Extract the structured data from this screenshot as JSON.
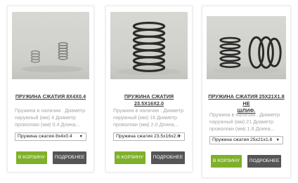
{
  "products": [
    {
      "title": "ПРУЖИНА СЖАТИЯ 8Х4Х0.4",
      "desc_lines": [
        "Пружина в наличии . Диаметр",
        "наружный (мм) 4 Диаметр",
        "проволоки (мм) 0.4 Длина..."
      ],
      "selected_option": "Пружина сжатия 8х4х0.4",
      "cart_label": "В КОРЗИНУ",
      "more_label": "ПОДРОБНЕЕ"
    },
    {
      "title": "ПРУЖИНА СЖАТИЯ 23.5Х16Х2.0",
      "desc_lines": [
        "Пружина в наличии . Диаметр",
        "наружный (мм) 16 Диаметр",
        "проволоки (мм) 2.0 Длина..."
      ],
      "selected_option": "Пружина сжатия 23.5х16х2.0",
      "cart_label": "В КОРЗИНУ",
      "more_label": "ПОДРОБНЕЕ"
    },
    {
      "title_lines": [
        "ПРУЖИНА СЖАТИЯ 25Х21Х1.8 НЕ",
        "ШЛИФ."
      ],
      "desc_lines": [
        "Пружина в наличии . Диаметр",
        "наружный (мм) 21 Диаметр",
        "проволоки (мм) 1.8 Длина..."
      ],
      "selected_option": "Пружина сжатия 25х21х1.8",
      "cart_label": "В КОРЗИНУ",
      "more_label": "ПОДРОБНЕЕ"
    }
  ],
  "icons": {
    "product_photo": "spring-photo-icon",
    "select_arrow": "triangle-down-icon"
  },
  "colors": {
    "cart_button": "#7fb029",
    "more_button": "#555555",
    "title": "#3a3a3a",
    "description": "#a6a6a6"
  }
}
